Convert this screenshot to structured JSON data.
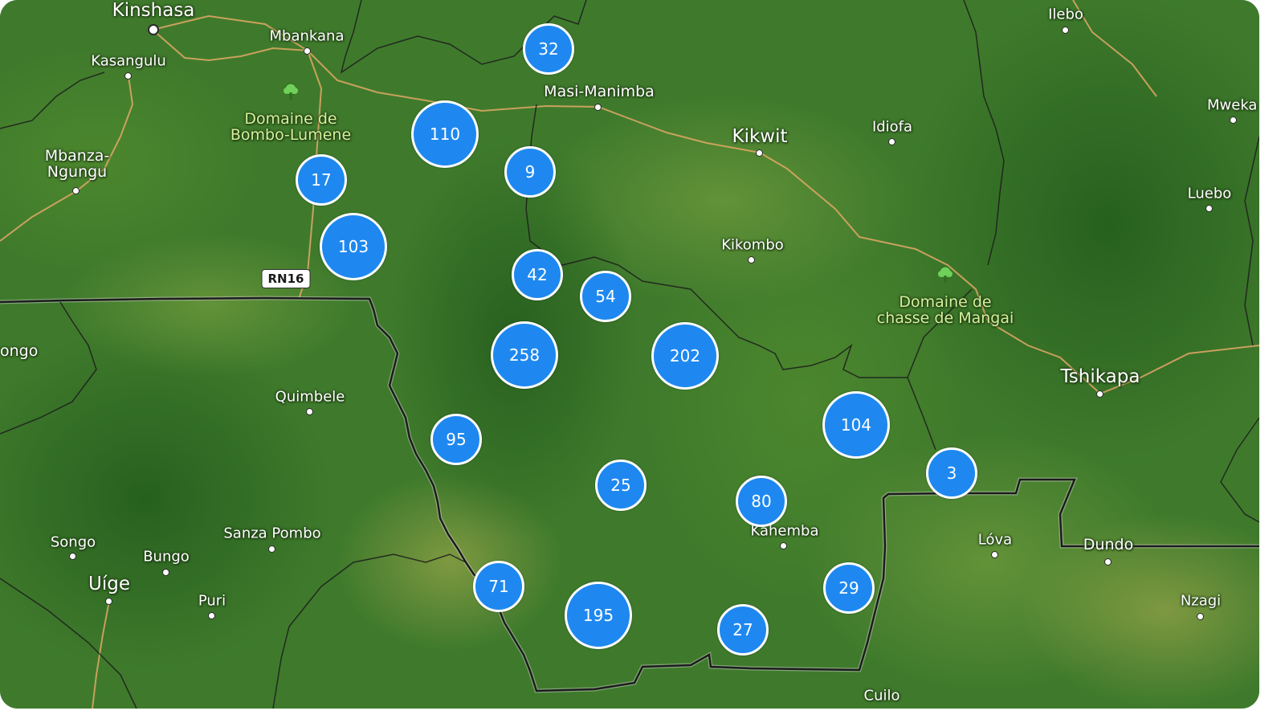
{
  "map": {
    "colors": {
      "cluster_fill": "#1e88f0",
      "cluster_border": "#ffffff",
      "border_line": "#1c1c1c",
      "road": "#e0a866",
      "park_label": "#d6f09a"
    },
    "places": {
      "kinshasa": "Kinshasa",
      "mbankana": "Mbankana",
      "kasangulu": "Kasangulu",
      "mbanza_ngungu": "Mbanza-\nNgungu",
      "domaine_bombo": "Domaine de\nBombo-Lumene",
      "masi_manimba": "Masi-Manimba",
      "kikwit": "Kikwit",
      "idiofa": "Idiofa",
      "ilebo": "Ilebo",
      "mweka": "Mweka",
      "luebo": "Luebo",
      "kikombo": "Kikombo",
      "domaine_mangai": "Domaine de\nchasse de Mangai",
      "tshikapa": "Tshikapa",
      "ongo": "ongo",
      "quimbele": "Quimbele",
      "songo": "Songo",
      "bungo": "Bungo",
      "sanza_pombo": "Sanza Pombo",
      "uige": "Uíge",
      "puri": "Puri",
      "kahemba": "Kahemba",
      "lova": "Lóva",
      "dundo": "Dundo",
      "nzagi": "Nzagi",
      "cuilo": "Cuilo"
    },
    "road_shield": "RN16",
    "clusters": [
      {
        "id": "c32",
        "count": "32"
      },
      {
        "id": "c110",
        "count": "110"
      },
      {
        "id": "c9",
        "count": "9"
      },
      {
        "id": "c17",
        "count": "17"
      },
      {
        "id": "c103",
        "count": "103"
      },
      {
        "id": "c42",
        "count": "42"
      },
      {
        "id": "c54",
        "count": "54"
      },
      {
        "id": "c258",
        "count": "258"
      },
      {
        "id": "c202",
        "count": "202"
      },
      {
        "id": "c95",
        "count": "95"
      },
      {
        "id": "c25",
        "count": "25"
      },
      {
        "id": "c80",
        "count": "80"
      },
      {
        "id": "c104",
        "count": "104"
      },
      {
        "id": "c3",
        "count": "3"
      },
      {
        "id": "c71",
        "count": "71"
      },
      {
        "id": "c195",
        "count": "195"
      },
      {
        "id": "c29",
        "count": "29"
      },
      {
        "id": "c27",
        "count": "27"
      }
    ]
  }
}
